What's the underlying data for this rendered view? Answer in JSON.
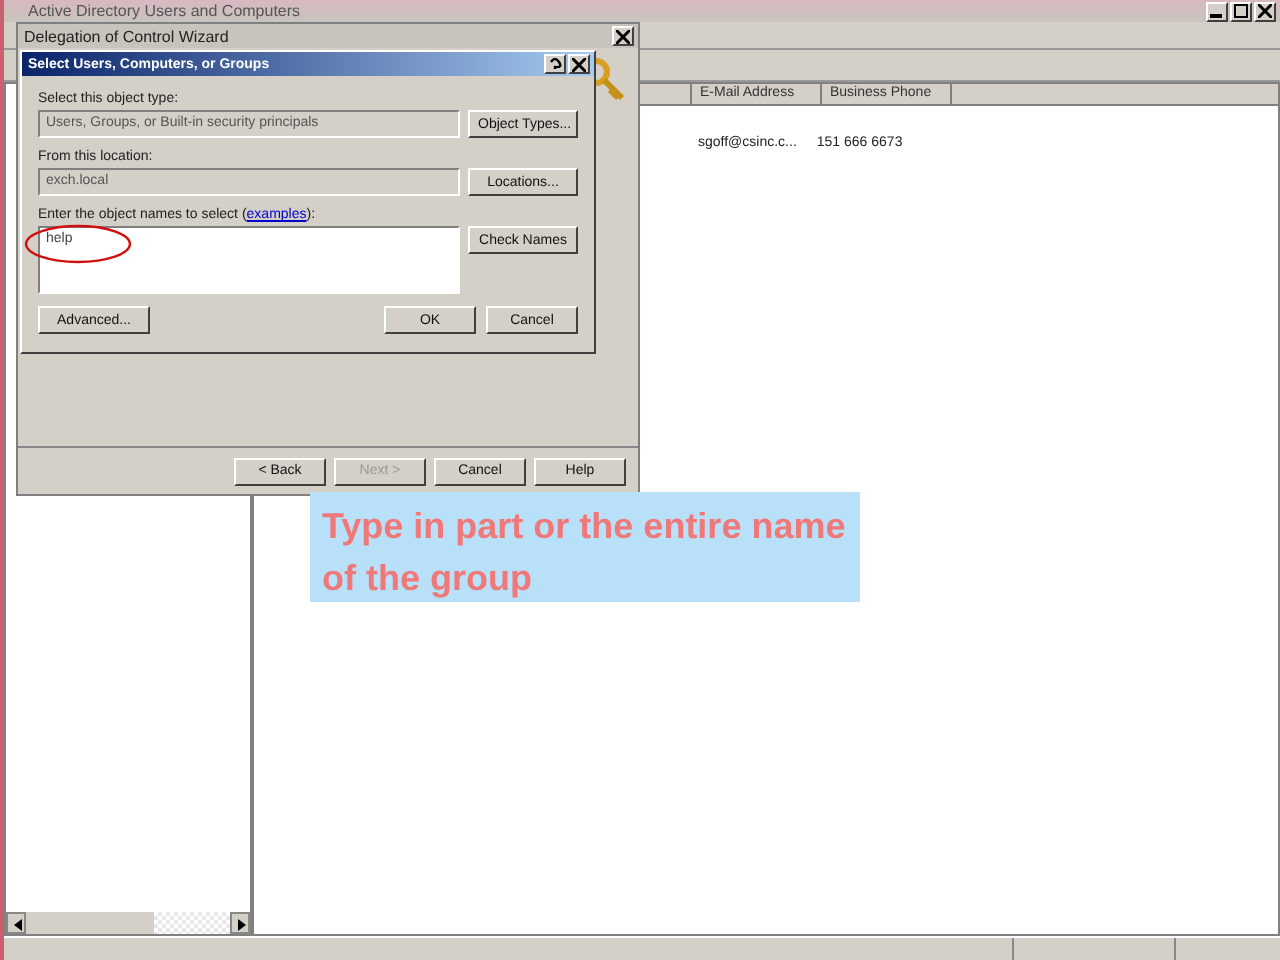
{
  "main_window": {
    "title": "Active Directory Users and Computers",
    "columns": [
      {
        "label": "E-Mail Address"
      },
      {
        "label": "Business Phone"
      }
    ],
    "rows": [
      {
        "email": "sgoff@csinc.c...",
        "phone": "151 666 6673"
      }
    ]
  },
  "wizard": {
    "title": "Delegation of Control Wizard",
    "buttons": [
      {
        "label": "< Back",
        "disabled": false
      },
      {
        "label": "Next >",
        "disabled": true
      },
      {
        "label": "Cancel",
        "disabled": false
      },
      {
        "label": "Help",
        "disabled": false
      }
    ]
  },
  "dialog": {
    "title": "Select Users, Computers, or Groups",
    "object_type_label": "Select this object type:",
    "object_type": "Users, Groups, or Built-in security principals",
    "object_types_button": "Object Types...",
    "location_label": "From this location:",
    "location": "exch.local",
    "locations_button": "Locations...",
    "names_label_prefix": "Enter the object names to select (",
    "names_label_link": "examples",
    "names_label_suffix": "):",
    "names_value": "help",
    "check_names_button": "Check Names",
    "advanced_button": "Advanced...",
    "ok_button": "OK",
    "cancel_button": "Cancel"
  },
  "callout": {
    "text": "Type in part or the entire name of the group"
  }
}
